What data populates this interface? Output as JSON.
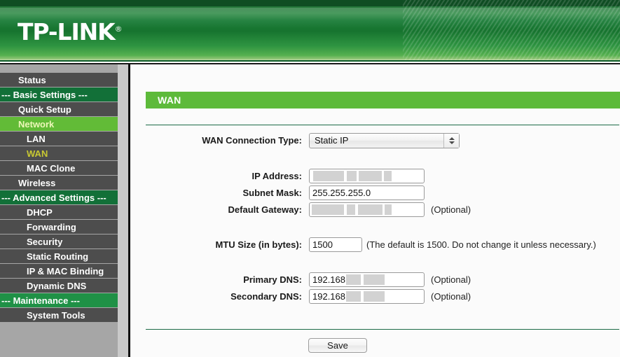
{
  "header": {
    "logo_text": "TP-LINK",
    "logo_registered": "®"
  },
  "sidebar": {
    "items": [
      {
        "label": "Status",
        "type": "item"
      },
      {
        "label": "--- Basic Settings ---",
        "type": "section"
      },
      {
        "label": "Quick Setup",
        "type": "item"
      },
      {
        "label": "Network",
        "type": "active"
      },
      {
        "label": "LAN",
        "type": "sub"
      },
      {
        "label": "WAN",
        "type": "sub-current"
      },
      {
        "label": "MAC Clone",
        "type": "sub"
      },
      {
        "label": "Wireless",
        "type": "item"
      },
      {
        "label": "--- Advanced Settings ---",
        "type": "section"
      },
      {
        "label": "DHCP",
        "type": "sub"
      },
      {
        "label": "Forwarding",
        "type": "sub"
      },
      {
        "label": "Security",
        "type": "sub"
      },
      {
        "label": "Static Routing",
        "type": "sub"
      },
      {
        "label": "IP & MAC Binding",
        "type": "sub"
      },
      {
        "label": "Dynamic DNS",
        "type": "sub"
      },
      {
        "label": "--- Maintenance ---",
        "type": "section-light"
      },
      {
        "label": "System Tools",
        "type": "sub"
      }
    ]
  },
  "panel": {
    "title": "WAN"
  },
  "form": {
    "connection_type": {
      "label": "WAN Connection Type:",
      "value": "Static IP"
    },
    "ip_address": {
      "label": "IP Address:",
      "value": "",
      "redacted": true
    },
    "subnet_mask": {
      "label": "Subnet Mask:",
      "value": "255.255.255.0"
    },
    "default_gateway": {
      "label": "Default Gateway:",
      "value": "",
      "redacted": true,
      "note": "(Optional)"
    },
    "mtu_size": {
      "label": "MTU Size (in bytes):",
      "value": "1500",
      "note": "(The default is 1500. Do not change it unless necessary.)"
    },
    "primary_dns": {
      "label": "Primary DNS:",
      "value": "192.168",
      "redacted": true,
      "note": "(Optional)"
    },
    "secondary_dns": {
      "label": "Secondary DNS:",
      "value": "192.168",
      "redacted": true,
      "note": "(Optional)"
    }
  },
  "actions": {
    "save_label": "Save"
  },
  "colors": {
    "brand_green_dark": "#127038",
    "brand_green": "#5dba3a",
    "sidebar_active": "#62bb37",
    "sidebar_bg": "#4d4d4d",
    "sub_current_text": "#c8c832",
    "redaction": "#d2d2d2"
  }
}
